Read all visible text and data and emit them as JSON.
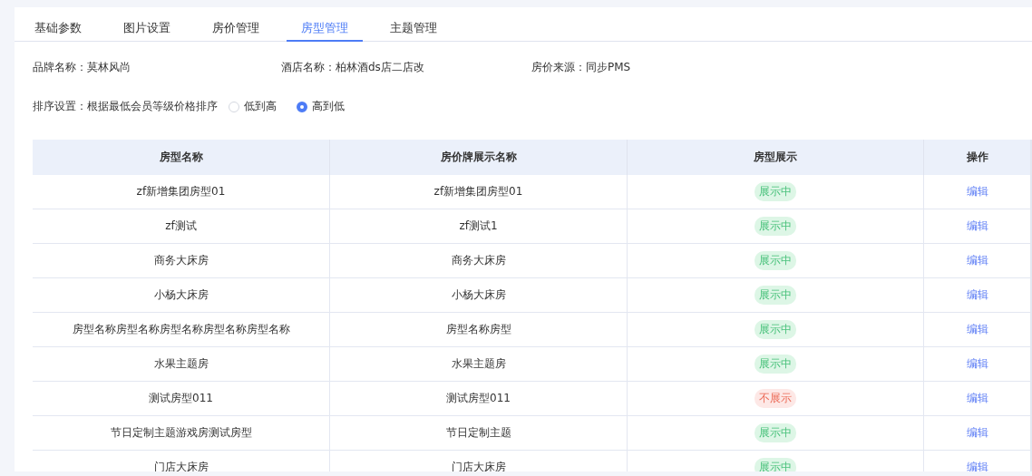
{
  "tabs": [
    {
      "label": "基础参数",
      "selected": false
    },
    {
      "label": "图片设置",
      "selected": false
    },
    {
      "label": "房价管理",
      "selected": false
    },
    {
      "label": "房型管理",
      "selected": true
    },
    {
      "label": "主题管理",
      "selected": false
    }
  ],
  "info": [
    {
      "label": "品牌名称：",
      "value": "莫林风尚"
    },
    {
      "label": "酒店名称：",
      "value": "柏林酒ds店二店改"
    },
    {
      "label": "房价来源：",
      "value": "同步PMS"
    }
  ],
  "sort": {
    "label": "排序设置：",
    "description": "根据最低会员等级价格排序",
    "options": [
      {
        "label": "低到高",
        "selected": false
      },
      {
        "label": "高到低",
        "selected": true
      }
    ]
  },
  "table": {
    "columns": [
      "房型名称",
      "房价牌展示名称",
      "房型展示",
      "操作"
    ],
    "rows": [
      {
        "name": "zf新增集团房型01",
        "display_name": "zf新增集团房型01",
        "status": "展示中",
        "shown": true,
        "action": "编辑"
      },
      {
        "name": "zf测试",
        "display_name": "zf测试1",
        "status": "展示中",
        "shown": true,
        "action": "编辑"
      },
      {
        "name": "商务大床房",
        "display_name": "商务大床房",
        "status": "展示中",
        "shown": true,
        "action": "编辑"
      },
      {
        "name": "小杨大床房",
        "display_name": "小杨大床房",
        "status": "展示中",
        "shown": true,
        "action": "编辑"
      },
      {
        "name": "房型名称房型名称房型名称房型名称房型名称",
        "display_name": "房型名称房型",
        "status": "展示中",
        "shown": true,
        "action": "编辑"
      },
      {
        "name": "水果主题房",
        "display_name": "水果主题房",
        "status": "展示中",
        "shown": true,
        "action": "编辑"
      },
      {
        "name": "测试房型011",
        "display_name": "测试房型011",
        "status": "不展示",
        "shown": false,
        "action": "编辑"
      },
      {
        "name": "节日定制主题游戏房测试房型",
        "display_name": "节日定制主题",
        "status": "展示中",
        "shown": true,
        "action": "编辑"
      },
      {
        "name": "门店大床房",
        "display_name": "门店大床房",
        "status": "展示中",
        "shown": true,
        "action": "编辑"
      }
    ]
  }
}
